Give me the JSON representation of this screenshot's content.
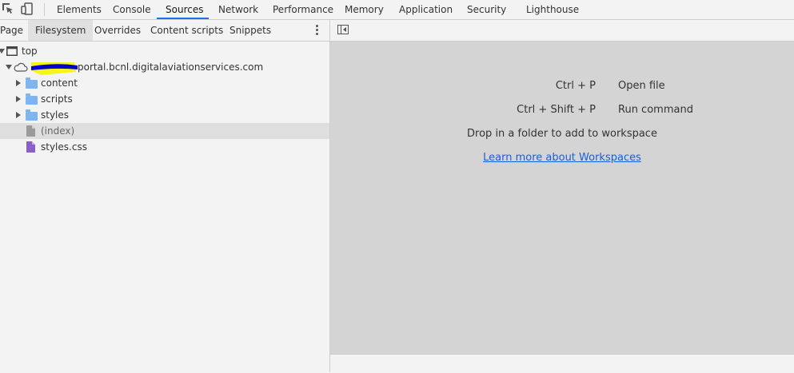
{
  "toolbar": {
    "tabs": [
      "Elements",
      "Console",
      "Sources",
      "Network",
      "Performance",
      "Memory",
      "Application",
      "Security",
      "Lighthouse"
    ],
    "active_tab": "Sources"
  },
  "navigator": {
    "tabs": [
      "Page",
      "Filesystem",
      "Overrides",
      "Content scripts",
      "Snippets"
    ],
    "selected_tab": "Filesystem"
  },
  "tree": {
    "top": "top",
    "origin": "portal.bcnl.digitalaviationservices.com",
    "folders": [
      "content",
      "scripts",
      "styles"
    ],
    "files": [
      "(index)",
      "styles.css"
    ]
  },
  "editor": {
    "shortcuts": [
      {
        "key": "Ctrl + P",
        "desc": "Open file"
      },
      {
        "key": "Ctrl + Shift + P",
        "desc": "Run command"
      }
    ],
    "drop_text": "Drop in a folder to add to workspace",
    "learn_link": "Learn more about Workspaces"
  },
  "colors": {
    "accent": "#1a73e8",
    "folder": "#7cb5f0",
    "css_file": "#8a5fc8",
    "redaction": "#0000cc",
    "highlight": "#f5f500"
  }
}
